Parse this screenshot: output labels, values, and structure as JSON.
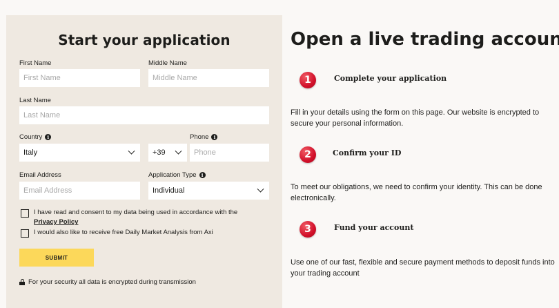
{
  "form": {
    "title": "Start your application",
    "first_name": {
      "label": "First Name",
      "placeholder": "First Name"
    },
    "middle_name": {
      "label": "Middle Name",
      "placeholder": "Middle Name"
    },
    "last_name": {
      "label": "Last Name",
      "placeholder": "Last Name"
    },
    "country": {
      "label": "Country",
      "value": "Italy"
    },
    "phone_code": {
      "value": "+39"
    },
    "phone": {
      "label": "Phone",
      "placeholder": "Phone"
    },
    "email": {
      "label": "Email Address",
      "placeholder": "Email Address"
    },
    "application_type": {
      "label": "Application Type",
      "value": "Individual"
    },
    "consent": {
      "text": "I have read and consent to my data being used in accordance with the",
      "link": "Privacy Policy",
      "checked": false
    },
    "newsletter": {
      "text": "I would also like to receive free Daily Market Analysis from Axi",
      "checked": false
    },
    "submit_label": "SUBMIT",
    "security_note": "For your security all data is encrypted during transmission",
    "info_icon_glyph": "i"
  },
  "info": {
    "title": "Open a live trading account",
    "steps": [
      {
        "number": "1",
        "title": "Complete your application",
        "description": "Fill in your details using the form on this page. Our website is encrypted to secure your personal information."
      },
      {
        "number": "2",
        "title": "Confirm your ID",
        "description": "To meet our obligations, we need to confirm your identity. This can be done electronically."
      },
      {
        "number": "3",
        "title": "Fund your account",
        "description": "Use one of our fast, flexible and secure payment methods to deposit funds into your trading account"
      }
    ]
  },
  "colors": {
    "panel_bg": "#efe9e1",
    "page_bg": "#faf8f6",
    "submit_bg": "#fcd85a",
    "badge_red": "#d2102a",
    "text": "#1d1d1b"
  }
}
